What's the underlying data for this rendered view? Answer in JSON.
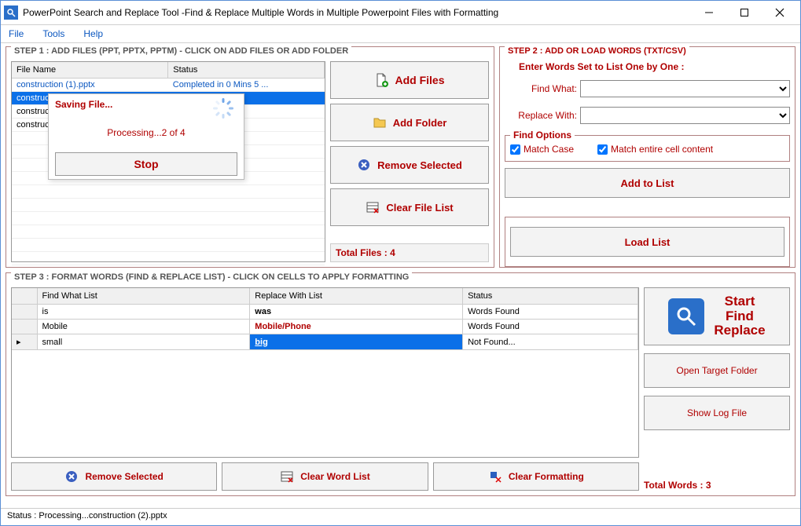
{
  "window": {
    "title": "PowerPoint Search and Replace Tool -Find & Replace Multiple Words in Multiple Powerpoint Files with Formatting"
  },
  "menu": {
    "file": "File",
    "tools": "Tools",
    "help": "Help"
  },
  "step1": {
    "legend": "STEP 1 : ADD FILES (PPT, PPTX, PPTM) - CLICK ON ADD FILES OR ADD FOLDER",
    "columns": {
      "filename": "File Name",
      "status": "Status"
    },
    "rows": [
      {
        "name": "construction (1).pptx",
        "status": "Completed in 0 Mins 5 ..."
      },
      {
        "name": "construc",
        "status": ""
      },
      {
        "name": "construc",
        "status": ""
      },
      {
        "name": "construc",
        "status": ""
      }
    ],
    "buttons": {
      "add_files": "Add Files",
      "add_folder": "Add Folder",
      "remove_selected": "Remove Selected",
      "clear_list": "Clear File List"
    },
    "total_files_label": "Total Files : 4"
  },
  "step2": {
    "legend": "STEP 2 : ADD OR LOAD WORDS (TXT/CSV)",
    "enter_label": "Enter Words Set to List One by One :",
    "find_what_label": "Find What:",
    "replace_with_label": "Replace With:",
    "find_options_label": "Find Options",
    "match_case": "Match Case",
    "match_entire": "Match entire cell content",
    "add_to_list": "Add to List",
    "load_list": "Load List"
  },
  "step3": {
    "legend": "STEP 3 : FORMAT WORDS (FIND & REPLACE LIST) - CLICK ON CELLS TO APPLY FORMATTING",
    "columns": {
      "find": "Find What List",
      "replace": "Replace With List",
      "status": "Status"
    },
    "rows": [
      {
        "find": "is",
        "replace": "was",
        "status": "Words Found"
      },
      {
        "find": "Mobile",
        "replace": "Mobile/Phone",
        "status": "Words Found"
      },
      {
        "find": "small",
        "replace": "big",
        "status": "Not Found..."
      }
    ],
    "buttons": {
      "remove_selected": "Remove Selected",
      "clear_word_list": "Clear Word List",
      "clear_formatting": "Clear Formatting"
    },
    "right": {
      "start": "Start\nFind\nReplace",
      "open_folder": "Open Target Folder",
      "show_log": "Show Log File",
      "total_words": "Total Words : 3"
    }
  },
  "saving_dialog": {
    "title": "Saving File...",
    "processing": "Processing...2 of 4",
    "stop": "Stop"
  },
  "statusbar": "Status  :  Processing...construction (2).pptx"
}
